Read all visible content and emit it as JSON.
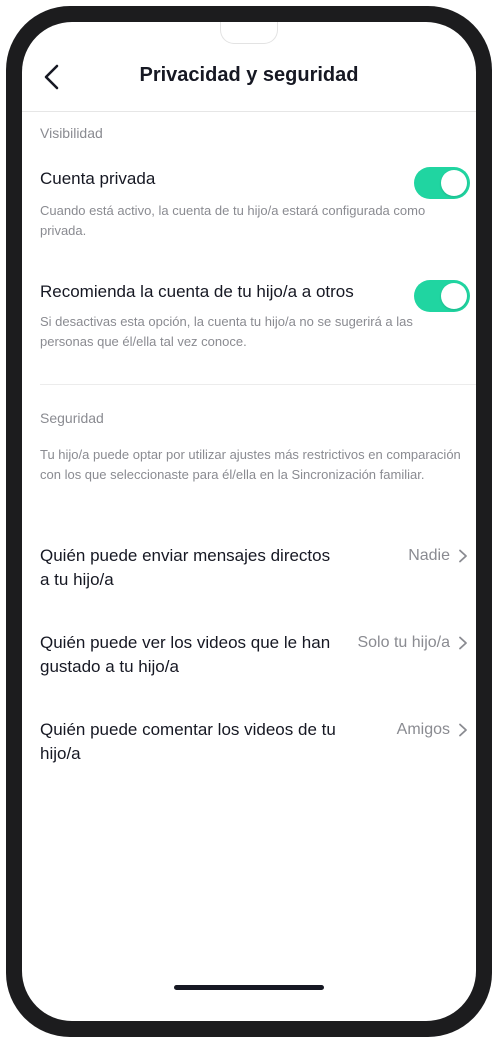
{
  "header": {
    "title": "Privacidad y seguridad"
  },
  "visibility": {
    "section_label": "Visibilidad",
    "private_account": {
      "title": "Cuenta privada",
      "description": "Cuando está activo, la cuenta de tu hijo/a estará configurada como privada.",
      "enabled": true
    },
    "recommend_account": {
      "title": "Recomienda la cuenta de tu hijo/a a otros",
      "description": "Si desactivas esta opción, la cuenta tu hijo/a no se sugerirá a las personas que él/ella tal vez conoce.",
      "enabled": true
    }
  },
  "security": {
    "section_label": "Seguridad",
    "description": "Tu hijo/a puede optar por utilizar ajustes más restrictivos en comparación con los que seleccionaste para él/ella en la Sincronización familiar.",
    "rows": [
      {
        "label": "Quién puede enviar mensajes directos a tu hijo/a",
        "value": "Nadie"
      },
      {
        "label": "Quién puede ver los videos que le han gustado a tu hijo/a",
        "value": "Solo tu hijo/a"
      },
      {
        "label": "Quién puede comentar los videos de tu hijo/a",
        "value": "Amigos"
      }
    ]
  },
  "colors": {
    "toggle_on": "#20d5a1",
    "text_primary": "#161823",
    "text_secondary": "#8a8b91"
  },
  "icons": {
    "back": "chevron-left-icon",
    "row_chevron": "chevron-right-icon"
  }
}
